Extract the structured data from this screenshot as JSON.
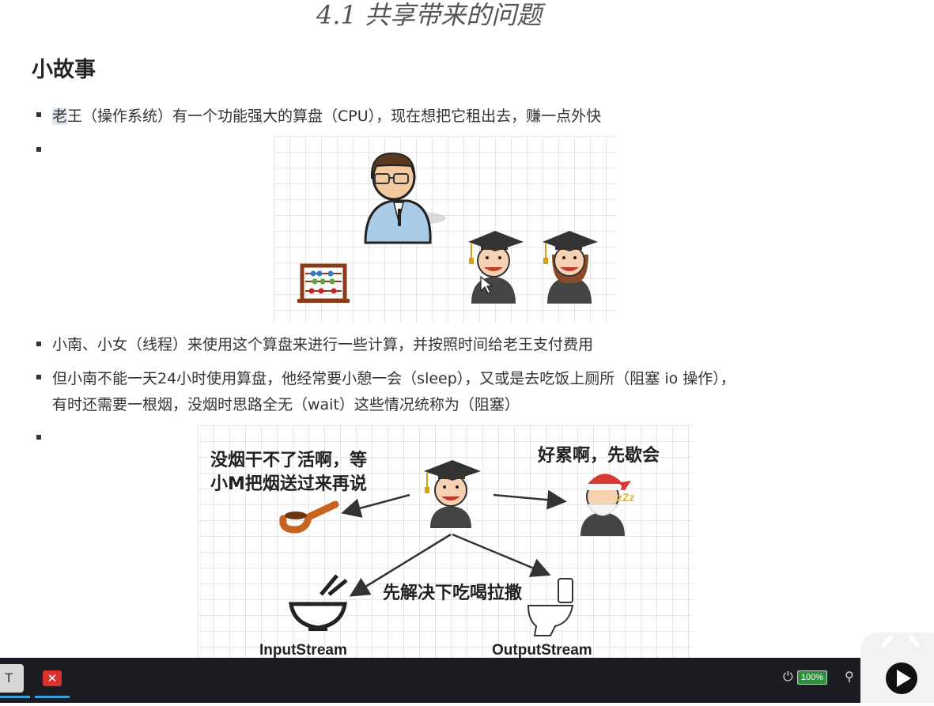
{
  "page": {
    "heading": "4.1 共享带来的问题",
    "section_title": "小故事",
    "bullets": {
      "b1_highlight": "老",
      "b1_rest": "王（操作系统）有一个功能强大的算盘（CPU），现在想把它租出去，赚一点外快",
      "b3": "小南、小女（线程）来使用这个算盘来进行一些计算，并按照时间给老王支付费用",
      "b4_line1": "但小南不能一天24小时使用算盘，他经常要小憩一会（sleep），又或是去吃饭上厕所（阻塞 io 操作），",
      "b4_line2": "有时还需要一根烟，没烟时思路全无（wait）这些情况统称为（阻塞）"
    }
  },
  "figure2": {
    "smoke_line1": "没烟干不了活啊，等",
    "smoke_line2": "小M把烟送过来再说",
    "tired": "好累啊，先歇会",
    "eat": "先解决下吃喝拉撒",
    "input": "InputStream",
    "output": "OutputStream"
  },
  "taskbar": {
    "battery": "100%"
  },
  "colors": {
    "taskbar": "#1b1d22",
    "battery": "#2f8f3f",
    "accent": "#3aa0d8"
  }
}
